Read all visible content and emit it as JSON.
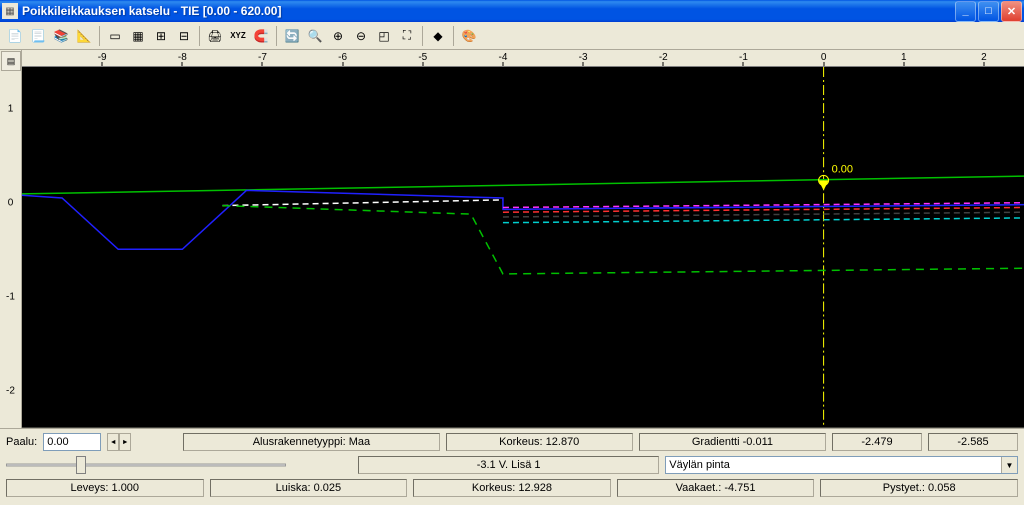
{
  "window": {
    "title": "Poikkileikkauksen katselu - TIE  [0.00 - 620.00]"
  },
  "toolbar": {
    "icons": [
      "document-icon",
      "page-icon",
      "stack-icon",
      "dimension-icon",
      "border-icon",
      "table-icon",
      "grid-icon",
      "grid2-icon",
      "print-icon",
      "xyz-icon",
      "magnet-icon",
      "refresh-icon",
      "zoom-fit-icon",
      "zoom-in-icon",
      "zoom-out-icon",
      "zoom-window-icon",
      "zoom-extents-icon",
      "eraser-icon",
      "palette-icon"
    ]
  },
  "chart_data": {
    "type": "line",
    "title": "",
    "xlabel": "",
    "ylabel": "",
    "xlim": [
      -10,
      2.5
    ],
    "ylim": [
      -2.4,
      1.4
    ],
    "x_ticks": [
      -9,
      -8,
      -7,
      -6,
      -5,
      -4,
      -3,
      -2,
      -1,
      0,
      1,
      2
    ],
    "y_ticks": [
      -2,
      -1,
      0,
      1
    ],
    "marker": {
      "x": 0.0,
      "label": "0.00",
      "y_arrow": 0.1
    },
    "series": [
      {
        "name": "green-solid",
        "color": "#00c000",
        "dash": "none",
        "points": [
          [
            -10.2,
            0.06
          ],
          [
            2.5,
            0.25
          ]
        ]
      },
      {
        "name": "blue-solid",
        "color": "#2020ff",
        "dash": "none",
        "points": [
          [
            -10.2,
            0.06
          ],
          [
            -9.5,
            0.02
          ],
          [
            -8.8,
            -0.52
          ],
          [
            -8.0,
            -0.52
          ],
          [
            -7.2,
            0.1
          ],
          [
            -4.0,
            0.02
          ],
          [
            -4.0,
            -0.1
          ],
          [
            2.5,
            -0.05
          ]
        ]
      },
      {
        "name": "white-dash",
        "color": "#ffffff",
        "dash": "6,4",
        "points": [
          [
            -7.5,
            -0.06
          ],
          [
            -4.0,
            0.0
          ]
        ]
      },
      {
        "name": "green-dash",
        "color": "#00c000",
        "dash": "8,6",
        "points": [
          [
            -7.5,
            -0.06
          ],
          [
            -4.4,
            -0.15
          ],
          [
            -4.0,
            -0.78
          ],
          [
            2.5,
            -0.72
          ]
        ]
      },
      {
        "name": "magenta-dash",
        "color": "#ff30ff",
        "dash": "6,4",
        "points": [
          [
            -4.0,
            -0.08
          ],
          [
            2.5,
            -0.03
          ]
        ]
      },
      {
        "name": "red-dash",
        "color": "#ff3030",
        "dash": "6,4",
        "points": [
          [
            -4.0,
            -0.13
          ],
          [
            2.5,
            -0.08
          ]
        ]
      },
      {
        "name": "black-dash",
        "color": "#404040",
        "dash": "6,4",
        "points": [
          [
            -4.0,
            -0.18
          ],
          [
            2.5,
            -0.13
          ]
        ]
      },
      {
        "name": "cyan-dash",
        "color": "#00d0d0",
        "dash": "6,4",
        "points": [
          [
            -4.0,
            -0.24
          ],
          [
            2.5,
            -0.19
          ]
        ]
      }
    ]
  },
  "status": {
    "paalu_label": "Paalu:",
    "paalu_value": "0.00",
    "alusrakenne_label": "Alusrakennetyyppi:",
    "alusrakenne_value": "Maa",
    "korkeus1_label": "Korkeus:",
    "korkeus1_value": "12.870",
    "gradientti_label": "Gradientti",
    "gradientti_value": "-0.011",
    "coord_x": "-2.479",
    "coord_y": "-2.585",
    "mid_text": "-3.1  V. Lisä 1",
    "dropdown_value": "Väylän pinta",
    "leveys_label": "Leveys:",
    "leveys_value": "1.000",
    "luiska_label": "Luiska:",
    "luiska_value": "0.025",
    "korkeus2_label": "Korkeus:",
    "korkeus2_value": "12.928",
    "vaakaet_label": "Vaakaet.:",
    "vaakaet_value": "-4.751",
    "pystyet_label": "Pystyet.:",
    "pystyet_value": "0.058"
  }
}
